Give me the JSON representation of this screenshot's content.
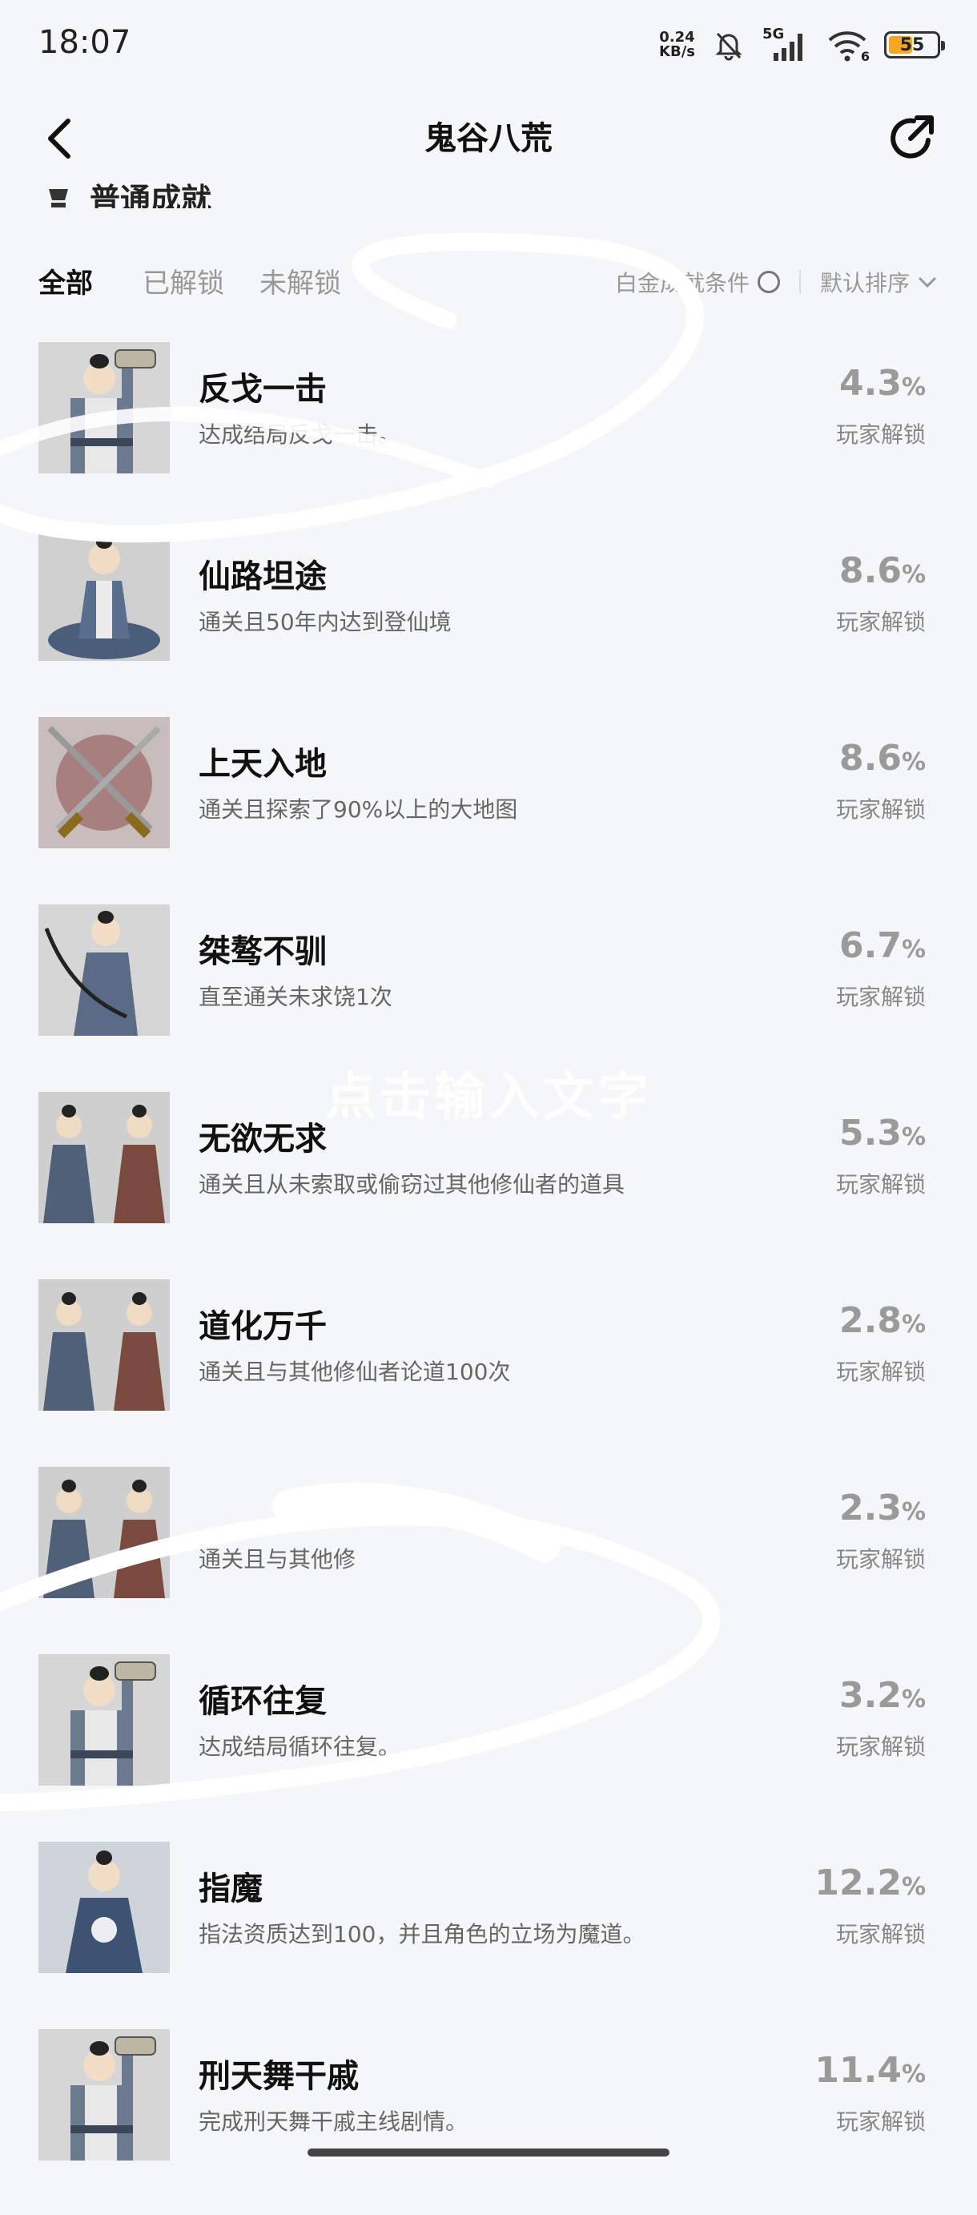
{
  "status_bar": {
    "time": "18:07",
    "net_speed_value": "0.24",
    "net_speed_unit": "KB/s",
    "signal": "5G",
    "wifi_badge": "6",
    "battery": "55",
    "battery_level": 0.55
  },
  "header": {
    "title": "鬼谷八荒",
    "back_icon": "chevron-left-icon",
    "share_icon": "share-arrow-icon"
  },
  "section": {
    "title": "普通成就"
  },
  "filters": {
    "tabs": [
      "全部",
      "已解锁",
      "未解锁"
    ],
    "active_tab": "全部",
    "condition_label": "白金成就条件",
    "sort_label": "默认排序"
  },
  "achievements": [
    {
      "name": "反戈一击",
      "desc": "达成结局反戈一击。",
      "pct": "4.3",
      "pct_sign": "%",
      "pct_label": "玩家解锁",
      "icon": "scholar-scroll-icon"
    },
    {
      "name": "仙路坦途",
      "desc": "通关且50年内达到登仙境",
      "pct": "8.6",
      "pct_sign": "%",
      "pct_label": "玩家解锁",
      "icon": "meditating-monk-icon"
    },
    {
      "name": "上天入地",
      "desc": "通关且探索了90%以上的大地图",
      "pct": "8.6",
      "pct_sign": "%",
      "pct_label": "玩家解锁",
      "icon": "crossed-swords-icon"
    },
    {
      "name": "桀骜不驯",
      "desc": "直至通关未求饶1次",
      "pct": "6.7",
      "pct_sign": "%",
      "pct_label": "玩家解锁",
      "icon": "swordsman-icon"
    },
    {
      "name": "无欲无求",
      "desc": "通关且从未索取或偷窃过其他修仙者的道具",
      "pct": "5.3",
      "pct_sign": "%",
      "pct_label": "玩家解锁",
      "icon": "two-cultivators-icon"
    },
    {
      "name": "道化万千",
      "desc": "通关且与其他修仙者论道100次",
      "pct": "2.8",
      "pct_sign": "%",
      "pct_label": "玩家解锁",
      "icon": "two-cultivators-icon"
    },
    {
      "name": "",
      "desc": "通关且与其他修",
      "pct": "2.3",
      "pct_sign": "%",
      "pct_label": "玩家解锁",
      "icon": "two-cultivators-icon"
    },
    {
      "name": "循环往复",
      "desc": "达成结局循环往复。",
      "pct": "3.2",
      "pct_sign": "%",
      "pct_label": "玩家解锁",
      "icon": "scholar-scroll-icon"
    },
    {
      "name": "指魔",
      "desc": "指法资质达到100，并且角色的立场为魔道。",
      "pct": "12.2",
      "pct_sign": "%",
      "pct_label": "玩家解锁",
      "icon": "glowing-cultivator-icon"
    },
    {
      "name": "刑天舞干戚",
      "desc": "完成刑天舞干戚主线剧情。",
      "pct": "11.4",
      "pct_sign": "%",
      "pct_label": "玩家解锁",
      "icon": "scholar-scroll-icon"
    }
  ],
  "overlay": {
    "text": "点击输入文字"
  }
}
